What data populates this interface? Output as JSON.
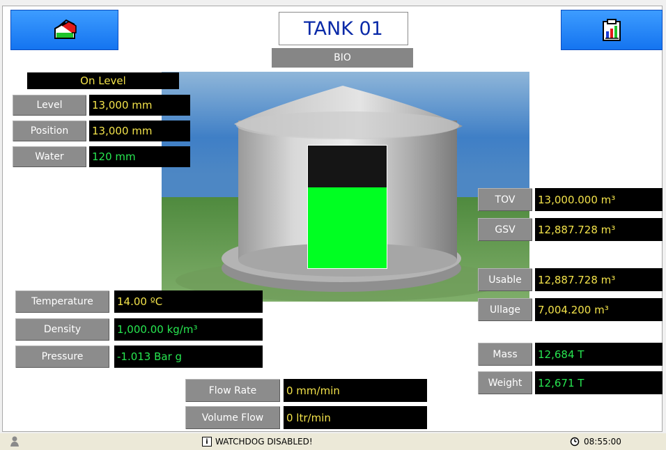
{
  "header": {
    "tank_title": "TANK 01",
    "product": "BIO"
  },
  "icons": {
    "left_button": "tank-levels-icon",
    "right_button": "report-clipboard-icon"
  },
  "level_panel": {
    "status": "On Level",
    "rows": [
      {
        "label": "Level",
        "value": "13,000 mm"
      },
      {
        "label": "Position",
        "value": "13,000 mm"
      },
      {
        "label": "Water",
        "value": "120 mm"
      }
    ]
  },
  "tank_visual": {
    "fill_fraction": 0.66
  },
  "conditions": [
    {
      "label": "Temperature",
      "value": "14.00 ºC"
    },
    {
      "label": "Density",
      "value": "1,000.00 kg/m³"
    },
    {
      "label": "Pressure",
      "value": "-1.013 Bar g"
    }
  ],
  "flow": [
    {
      "label": "Flow Rate",
      "value": "0 mm/min"
    },
    {
      "label": "Volume Flow",
      "value": "0 ltr/min"
    }
  ],
  "volumes": [
    {
      "label": "TOV",
      "value": "13,000.000 m³"
    },
    {
      "label": "GSV",
      "value": "12,887.728 m³"
    },
    {
      "label": "Usable",
      "value": "12,887.728 m³"
    },
    {
      "label": "Ullage",
      "value": "7,004.200 m³"
    },
    {
      "label": "Mass",
      "value": "12,684 T"
    },
    {
      "label": "Weight",
      "value": "12,671 T"
    }
  ],
  "status_bar": {
    "message": "WATCHDOG DISABLED!",
    "time": "08:55:00"
  },
  "colors": {
    "accent_blue": "#1f84ff",
    "value_yellow": "#f2e24a",
    "value_green": "#27e650",
    "label_gray": "#8c8c8c",
    "tank_fill": "#00ff22"
  }
}
